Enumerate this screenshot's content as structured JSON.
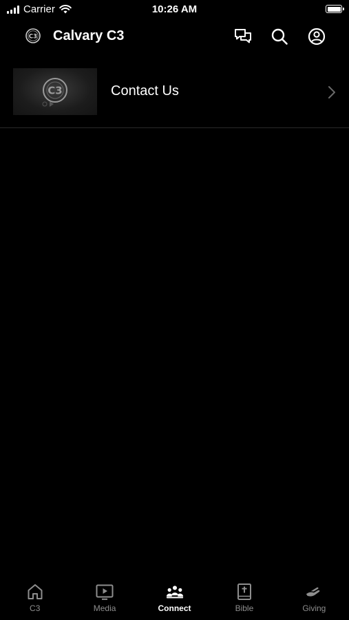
{
  "status_bar": {
    "carrier": "Carrier",
    "time": "10:26 AM"
  },
  "header": {
    "title": "Calvary C3",
    "icons": [
      "chat-icon",
      "search-icon",
      "profile-icon"
    ]
  },
  "list": {
    "items": [
      {
        "label": "Contact Us",
        "icon": "chevron-right-icon"
      }
    ]
  },
  "tab_bar": {
    "active": "Connect",
    "tabs": [
      {
        "label": "C3",
        "icon": "home-icon"
      },
      {
        "label": "Media",
        "icon": "play-icon"
      },
      {
        "label": "Connect",
        "icon": "people-icon"
      },
      {
        "label": "Bible",
        "icon": "bible-icon"
      },
      {
        "label": "Giving",
        "icon": "giving-hand-icon"
      }
    ]
  },
  "colors": {
    "background": "#000000",
    "text": "#ffffff",
    "inactive_tab": "#8e8e8e",
    "divider": "#2a2a2a"
  }
}
